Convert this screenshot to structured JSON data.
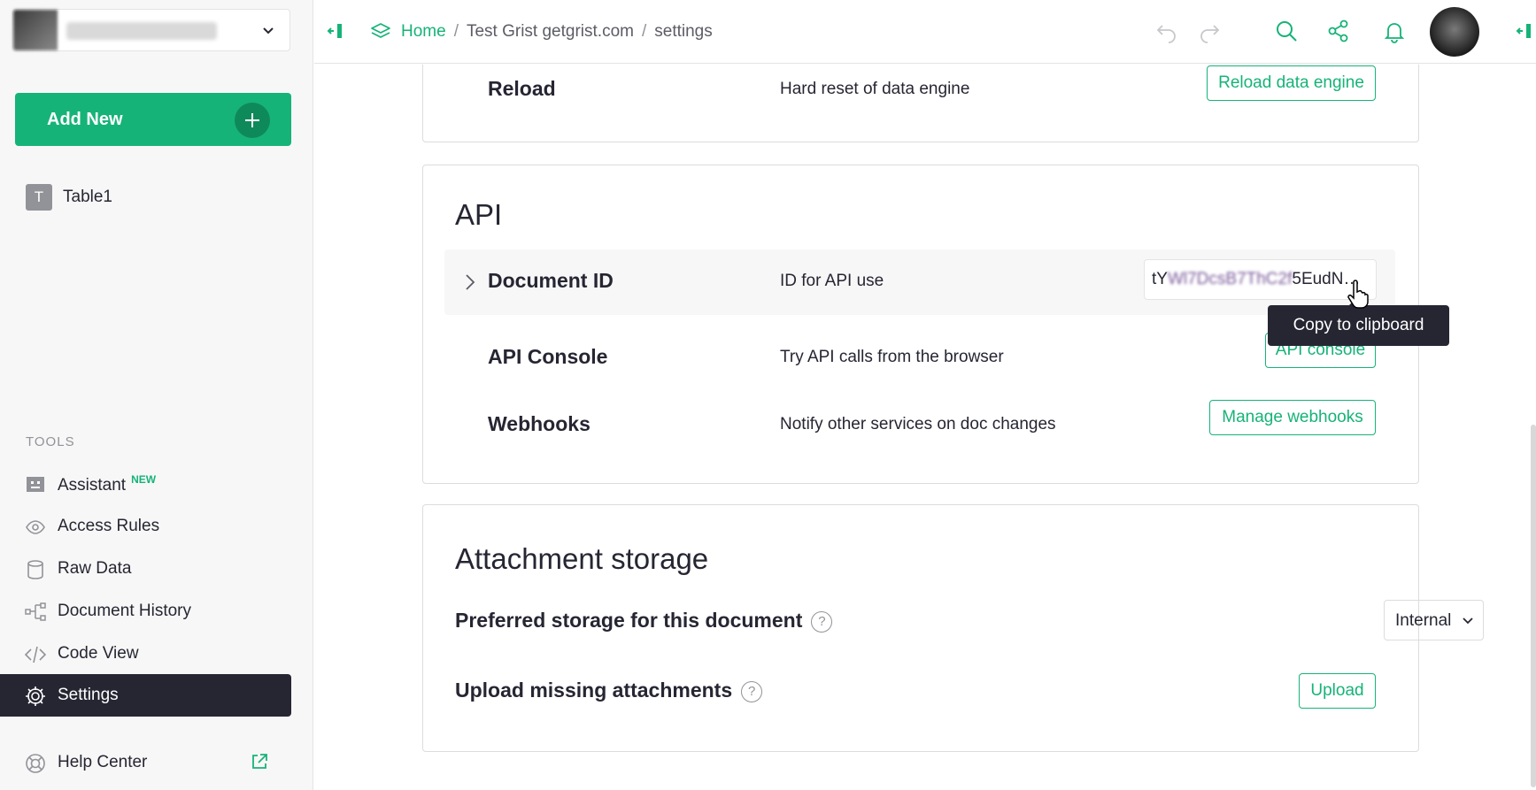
{
  "sidebar": {
    "add_new_label": "Add New",
    "pages": [
      {
        "badge": "T",
        "label": "Table1"
      }
    ],
    "tools_title": "TOOLS",
    "tools": [
      {
        "label": "Assistant",
        "tag": "NEW"
      },
      {
        "label": "Access Rules"
      },
      {
        "label": "Raw Data"
      },
      {
        "label": "Document History"
      },
      {
        "label": "Code View"
      },
      {
        "label": "Settings"
      }
    ],
    "help_label": "Help Center"
  },
  "breadcrumb": {
    "home": "Home",
    "sep1": "/",
    "doc": "Test Grist getgrist.com",
    "sep2": "/",
    "page": "settings"
  },
  "reload": {
    "title": "Reload",
    "desc": "Hard reset of data engine",
    "button": "Reload data engine"
  },
  "api": {
    "section_title": "API",
    "doc_id": {
      "title": "Document ID",
      "desc": "ID for API use",
      "value_start": "tY",
      "value_blurred": "Wl7DcsB7ThC2f",
      "value_end": "5EudN…"
    },
    "console": {
      "title": "API Console",
      "desc": "Try API calls from the browser",
      "button": "API console"
    },
    "webhooks": {
      "title": "Webhooks",
      "desc": "Notify other services on doc changes",
      "button": "Manage webhooks"
    },
    "tooltip": "Copy to clipboard"
  },
  "attachments": {
    "section_title": "Attachment storage",
    "preferred": {
      "label": "Preferred storage for this document",
      "help": "?",
      "value": "Internal"
    },
    "upload": {
      "label": "Upload missing attachments",
      "help": "?",
      "button": "Upload"
    }
  },
  "colors": {
    "accent": "#16b378",
    "dark": "#262633",
    "muted": "#929299"
  }
}
